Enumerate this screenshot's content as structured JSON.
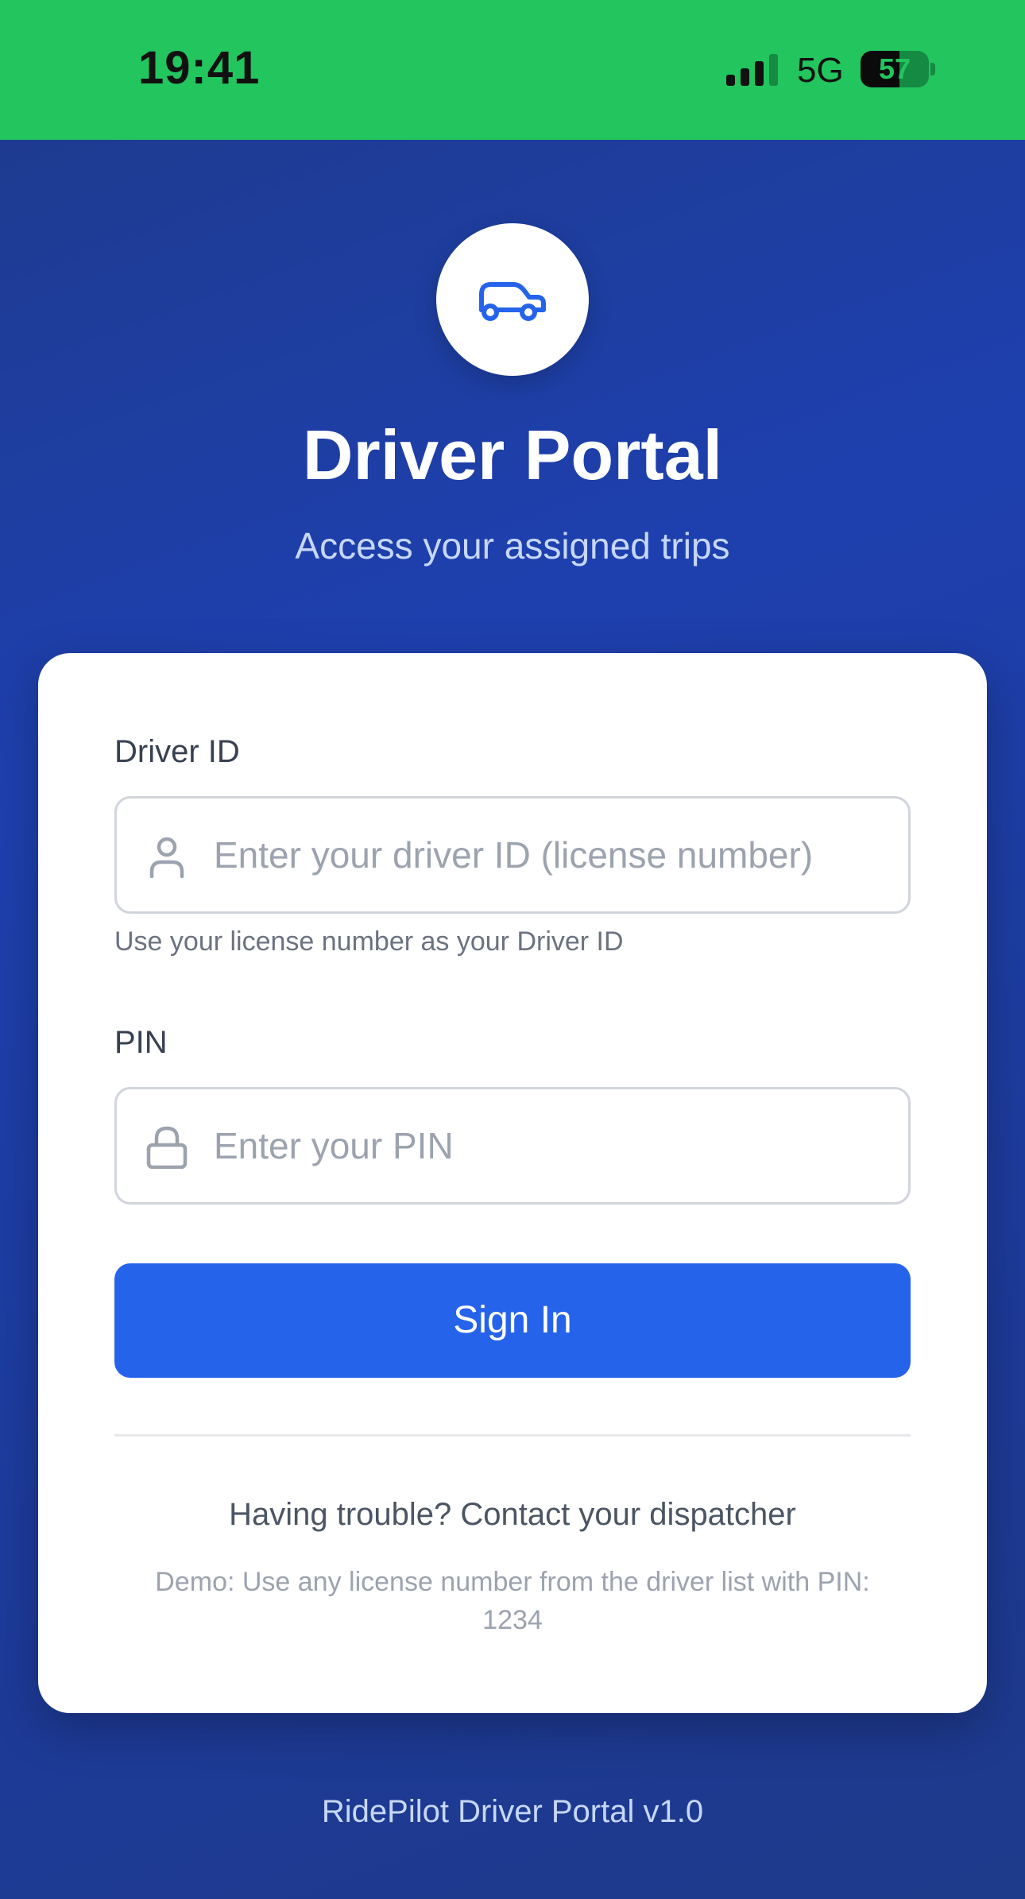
{
  "status_bar": {
    "time": "19:41",
    "network": "5G",
    "battery_level": "57",
    "battery_fraction": 0.57,
    "background_color": "#22c55e"
  },
  "header": {
    "logo_icon": "car-icon",
    "title": "Driver Portal",
    "subtitle": "Access your assigned trips"
  },
  "form": {
    "driver_id": {
      "label": "Driver ID",
      "placeholder": "Enter your driver ID (license number)",
      "icon": "user-icon",
      "hint": "Use your license number as your Driver ID"
    },
    "pin": {
      "label": "PIN",
      "placeholder": "Enter your PIN",
      "icon": "lock-icon"
    },
    "submit_label": "Sign In",
    "help_text": "Having trouble? Contact your dispatcher",
    "demo_note": "Demo: Use any license number from the driver list with PIN: 1234"
  },
  "footer": {
    "text": "RidePilot Driver Portal v1.0"
  },
  "colors": {
    "accent": "#2563eb",
    "background_gradient_start": "#1e3a8a",
    "background_gradient_end": "#1e40af"
  }
}
